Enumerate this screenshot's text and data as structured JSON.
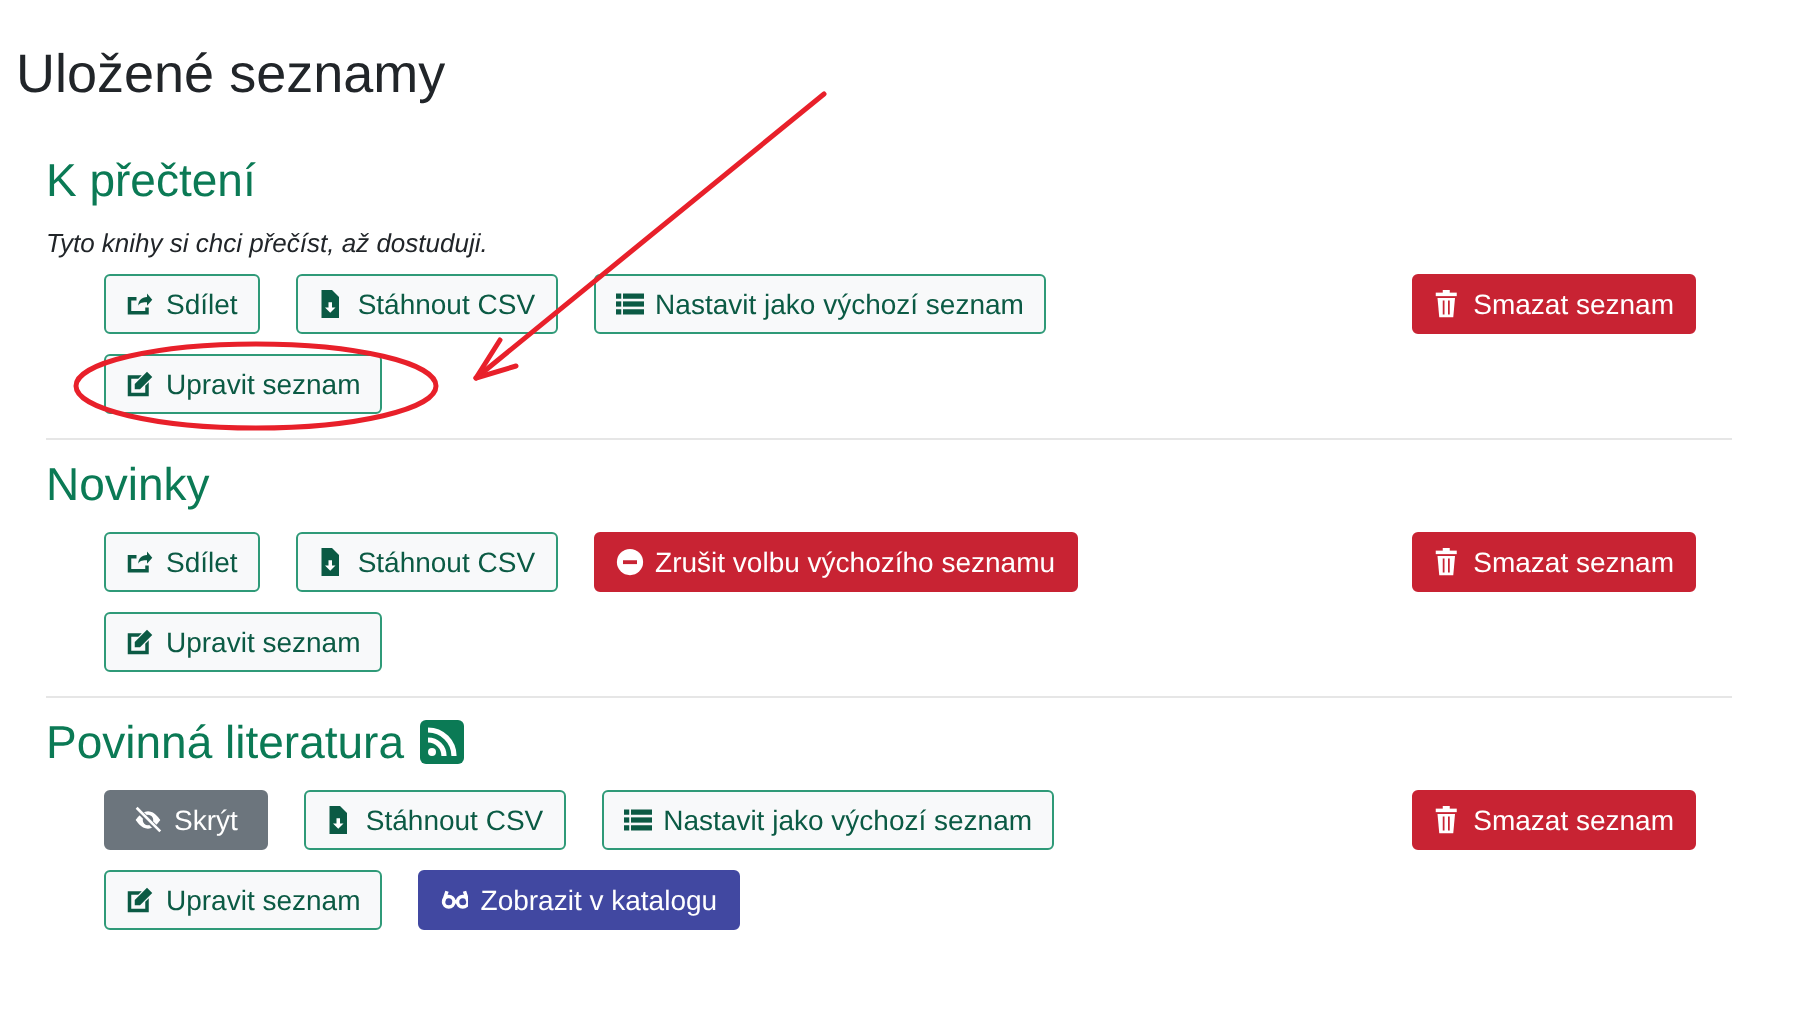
{
  "page_title": "Uložené seznamy",
  "lists": [
    {
      "title": "K přečtení",
      "rss": false,
      "description": "Tyto knihy si chci přečíst, až dostuduji.",
      "actions": [
        {
          "kind": "share",
          "label": "Sdílet"
        },
        {
          "kind": "download",
          "label": "Stáhnout CSV"
        },
        {
          "kind": "set-default",
          "label": "Nastavit jako výchozí seznam"
        },
        {
          "kind": "edit",
          "label": "Upravit seznam"
        }
      ],
      "delete_label": "Smazat seznam"
    },
    {
      "title": "Novinky",
      "rss": false,
      "actions": [
        {
          "kind": "share",
          "label": "Sdílet"
        },
        {
          "kind": "download",
          "label": "Stáhnout CSV"
        },
        {
          "kind": "unset-default",
          "label": "Zrušit volbu výchozího seznamu"
        },
        {
          "kind": "edit",
          "label": "Upravit seznam"
        }
      ],
      "delete_label": "Smazat seznam"
    },
    {
      "title": "Povinná literatura",
      "rss": true,
      "actions": [
        {
          "kind": "hide",
          "label": "Skrýt"
        },
        {
          "kind": "download",
          "label": "Stáhnout CSV"
        },
        {
          "kind": "set-default",
          "label": "Nastavit jako výchozí seznam"
        },
        {
          "kind": "edit",
          "label": "Upravit seznam"
        },
        {
          "kind": "catalog",
          "label": "Zobrazit v katalogu"
        }
      ],
      "delete_label": "Smazat seznam"
    }
  ]
}
